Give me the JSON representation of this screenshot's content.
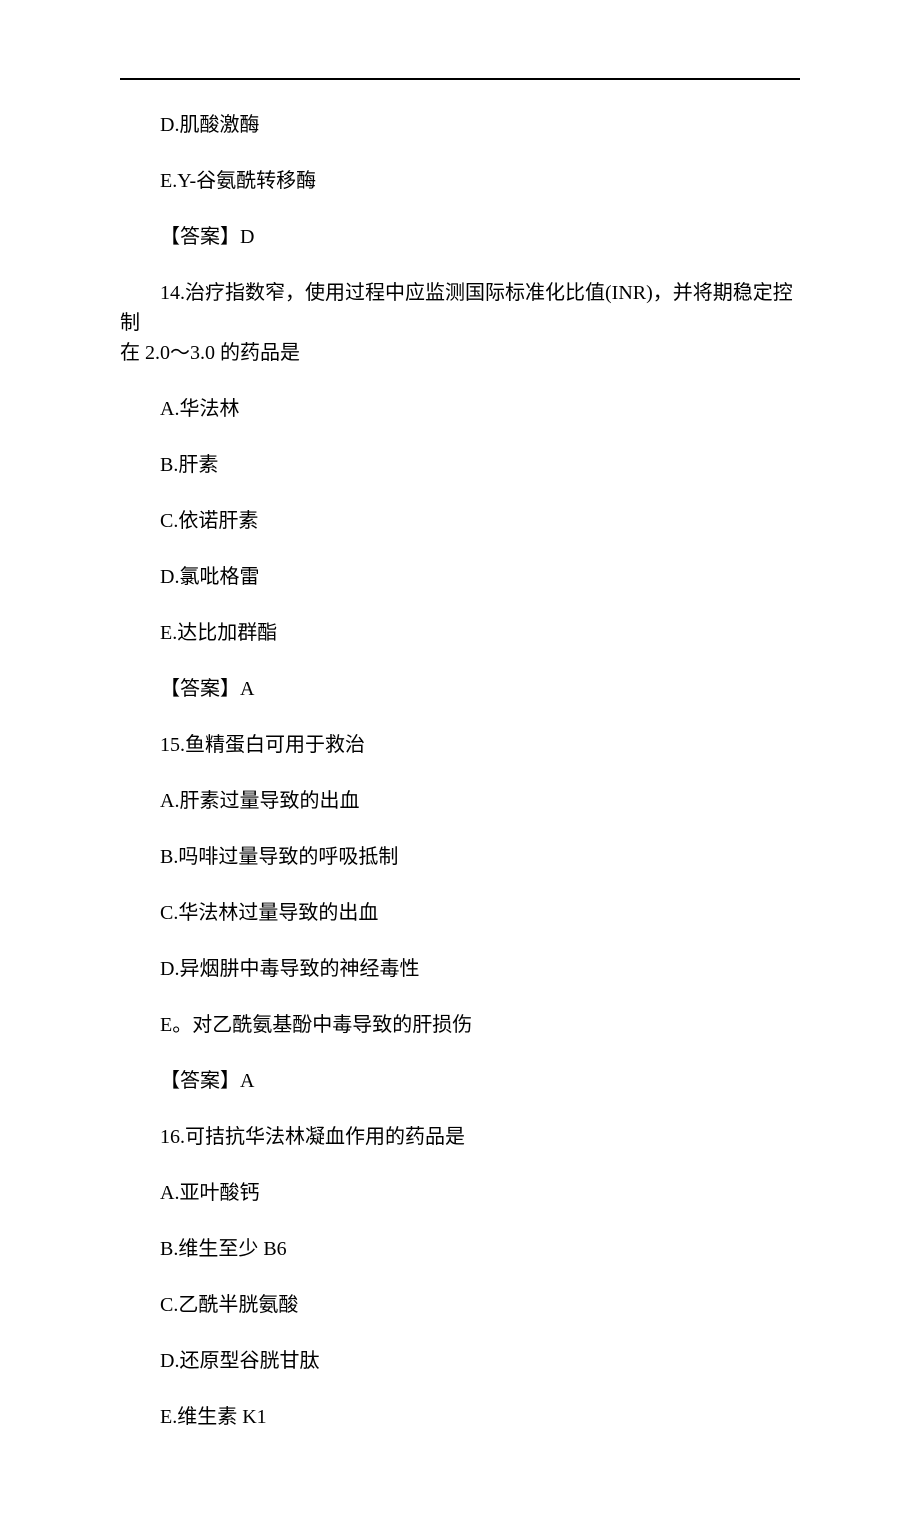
{
  "lines": {
    "p1": "D.肌酸激酶",
    "p2": "E.Y-谷氨酰转移酶",
    "p3": "【答案】D",
    "p4a": "14.治疗指数窄，使用过程中应监测国际标准化比值(INR)，并将期稳定控制",
    "p4b": "在 2.0～3.0 的药品是",
    "p5": "A.华法林",
    "p6": "B.肝素",
    "p7": "C.依诺肝素",
    "p8": "D.氯吡格雷",
    "p9": "E.达比加群酯",
    "p10": "【答案】A",
    "p11": "15.鱼精蛋白可用于救治",
    "p12": "A.肝素过量导致的出血",
    "p13": "B.吗啡过量导致的呼吸抵制",
    "p14": "C.华法林过量导致的出血",
    "p15": "D.异烟肼中毒导致的神经毒性",
    "p16": "E。对乙酰氨基酚中毒导致的肝损伤",
    "p17": "【答案】A",
    "p18": "16.可拮抗华法林凝血作用的药品是",
    "p19": "A.亚叶酸钙",
    "p20": "B.维生至少 B6",
    "p21": "C.乙酰半胱氨酸",
    "p22": "D.还原型谷胱甘肽",
    "p23": "E.维生素 K1"
  }
}
